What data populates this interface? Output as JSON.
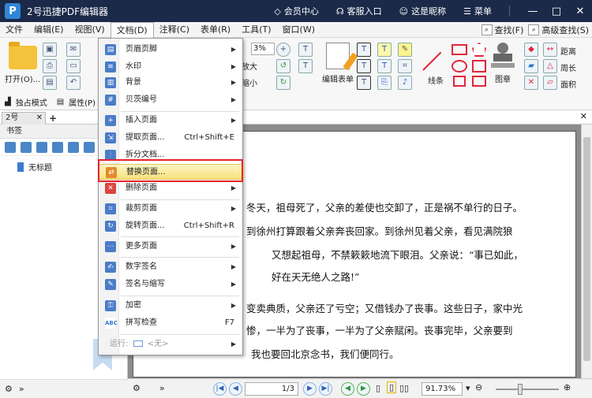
{
  "window": {
    "title": "2号迅捷PDF编辑器",
    "logo_letter": "P",
    "links": [
      {
        "label": "会员中心",
        "icon": "diamond-icon"
      },
      {
        "label": "客服入口",
        "icon": "headset-icon"
      },
      {
        "label": "这是昵称",
        "icon": "user-icon"
      },
      {
        "label": "菜单",
        "icon": "menu-icon"
      }
    ],
    "controls": [
      "—",
      "□",
      "✕"
    ]
  },
  "menubar": {
    "items": [
      "文件",
      "编辑(E)",
      "视图(V)",
      "文档(D)",
      "注释(C)",
      "表单(R)",
      "工具(T)",
      "窗口(W)"
    ],
    "find_label": "查找(F)",
    "advanced_find_label": "高级查找(S)"
  },
  "ribbon": {
    "open_label": "打开(O)...",
    "exclusive_mode": "独占模式",
    "properties": "属性(P)",
    "zoom_value": "3%",
    "zoom_in": "放大",
    "zoom_out": "缩小",
    "edit_form": "编辑表单",
    "line": "线条",
    "stamp": "图章",
    "distance": "距离",
    "perimeter": "周长",
    "area": "面积"
  },
  "tabs": {
    "doc_tab": "2号",
    "close": "✕",
    "add": "+"
  },
  "bookmark_panel": {
    "title": "书签",
    "item": "无标题"
  },
  "document": {
    "lines": [
      "冬天，祖母死了，父亲的差使也交卸了，正是祸不单行的日子。",
      "到徐州打算跟着父亲奔丧回家。到徐州见着父亲，看见满院狼",
      "又想起祖母，不禁簌簌地流下眼泪。父亲说：“事已如此，",
      "好在天无绝人之路!”",
      "变卖典质，父亲还了亏空；又借钱办了丧事。这些日子，家中光",
      "惨，一半为了丧事，一半为了父亲赋闲。丧事完毕，父亲要到",
      "我也要回北京念书，我们便同行。"
    ],
    "page_number": "1",
    "page_total": "/3",
    "zoom": "91.73%"
  },
  "dropdown": {
    "items": [
      {
        "label": "页眉页脚",
        "submenu": true,
        "shortcut": ""
      },
      {
        "label": "水印",
        "submenu": true,
        "shortcut": ""
      },
      {
        "label": "背景",
        "submenu": true,
        "shortcut": ""
      },
      {
        "label": "贝茨编号",
        "submenu": true,
        "shortcut": ""
      },
      {
        "label": "插入页面",
        "submenu": true,
        "shortcut": ""
      },
      {
        "label": "提取页面...",
        "submenu": false,
        "shortcut": "Ctrl+Shift+E"
      },
      {
        "label": "拆分文档...",
        "submenu": false,
        "shortcut": ""
      },
      {
        "label": "替换页面...",
        "submenu": false,
        "shortcut": ""
      },
      {
        "label": "删除页面",
        "submenu": true,
        "shortcut": ""
      },
      {
        "label": "裁剪页面",
        "submenu": true,
        "shortcut": ""
      },
      {
        "label": "旋转页面...",
        "submenu": false,
        "shortcut": "Ctrl+Shift+R"
      },
      {
        "label": "更多页面",
        "submenu": true,
        "shortcut": ""
      },
      {
        "label": "数字签名",
        "submenu": true,
        "shortcut": ""
      },
      {
        "label": "签名与缩写",
        "submenu": true,
        "shortcut": ""
      },
      {
        "label": "加密",
        "submenu": true,
        "shortcut": ""
      },
      {
        "label": "拼写检查",
        "submenu": false,
        "shortcut": "F7"
      }
    ],
    "run_label": "运行:",
    "run_value": "<无>",
    "spell_icon_text": "ABC"
  },
  "colors": {
    "titlebar": "#1b2a49",
    "highlight_border": "#e3232f",
    "accent_blue": "#2f86d9"
  }
}
